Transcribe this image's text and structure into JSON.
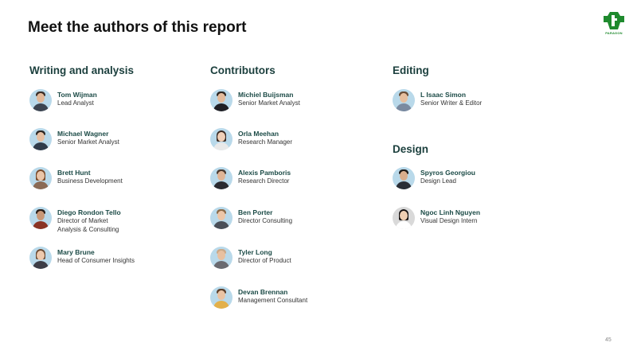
{
  "title": "Meet the authors of this report",
  "logo_text": "PARAGON",
  "page_number": "45",
  "colors": {
    "heading": "#1b3f3d",
    "name": "#1b4a46",
    "logo": "#1f8a2e",
    "avatar_bg": "#b9d9ea"
  },
  "sections": {
    "writing": {
      "heading": "Writing and analysis",
      "people": [
        {
          "name": "Tom Wijman",
          "role": [
            "Lead Analyst"
          ]
        },
        {
          "name": "Michael Wagner",
          "role": [
            "Senior Market Analyst"
          ]
        },
        {
          "name": "Brett Hunt",
          "role": [
            "Business Development"
          ]
        },
        {
          "name": "Diego Rondon Tello",
          "role": [
            "Director of Market",
            "Analysis & Consulting"
          ]
        },
        {
          "name": "Mary Brune",
          "role": [
            "Head of Consumer Insights"
          ]
        }
      ]
    },
    "contributors": {
      "heading": "Contributors",
      "people": [
        {
          "name": "Michiel Buijsman",
          "role": [
            "Senior Market Analyst"
          ]
        },
        {
          "name": "Orla Meehan",
          "role": [
            "Research Manager"
          ]
        },
        {
          "name": "Alexis Pamboris",
          "role": [
            "Research Director"
          ]
        },
        {
          "name": "Ben Porter",
          "role": [
            "Director Consulting"
          ]
        },
        {
          "name": "Tyler Long",
          "role": [
            "Director of Product"
          ]
        },
        {
          "name": "Devan Brennan",
          "role": [
            "Management Consultant"
          ]
        }
      ]
    },
    "editing": {
      "heading": "Editing",
      "people": [
        {
          "name": "L Isaac Simon",
          "role": [
            "Senior Writer & Editor"
          ]
        }
      ]
    },
    "design": {
      "heading": "Design",
      "people": [
        {
          "name": "Spyros Georgiou",
          "role": [
            "Design Lead"
          ]
        },
        {
          "name": "Ngoc Linh Nguyen",
          "role": [
            "Visual Design Intern"
          ]
        }
      ]
    }
  }
}
